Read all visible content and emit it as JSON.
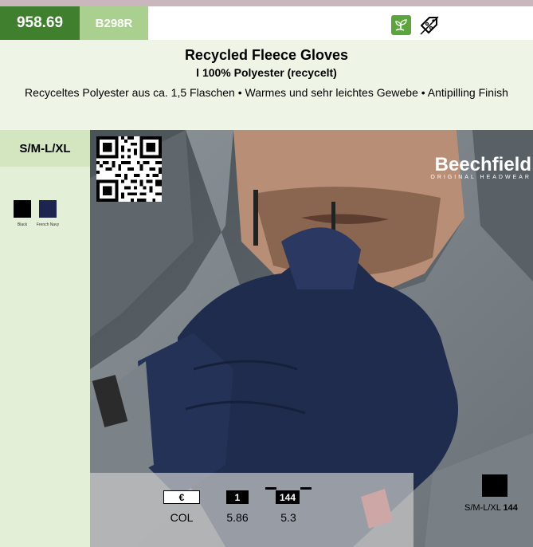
{
  "header": {
    "article_number": "958.69",
    "supplier_code": "B298R",
    "icons": [
      "eco-plant-icon",
      "discount-tag-icon"
    ]
  },
  "product": {
    "title": "Recycled Fleece Gloves",
    "subtitle": "l 100% Polyester (recycelt)",
    "description": "Recyceltes Polyester aus ca. 1,5 Flaschen • Warmes und sehr leichtes Gewebe • Antipilling Finish"
  },
  "sidebar": {
    "sizes": "S/M-L/XL",
    "colors": [
      {
        "name": "Black",
        "hex": "#000000"
      },
      {
        "name": "French Navy",
        "hex": "#1d2450"
      }
    ]
  },
  "brand": {
    "name": "Beechfield",
    "tagline": "ORIGINAL HEADWEAR",
    "registered": "®"
  },
  "pricing": {
    "currency_label": "€",
    "qty1_label": "1",
    "qty2_label": "144",
    "row_label": "COL",
    "price1": "5.86",
    "price2": "5.3"
  },
  "packaging": {
    "size_label": "S/M-L/XL",
    "carton_qty": "144"
  }
}
